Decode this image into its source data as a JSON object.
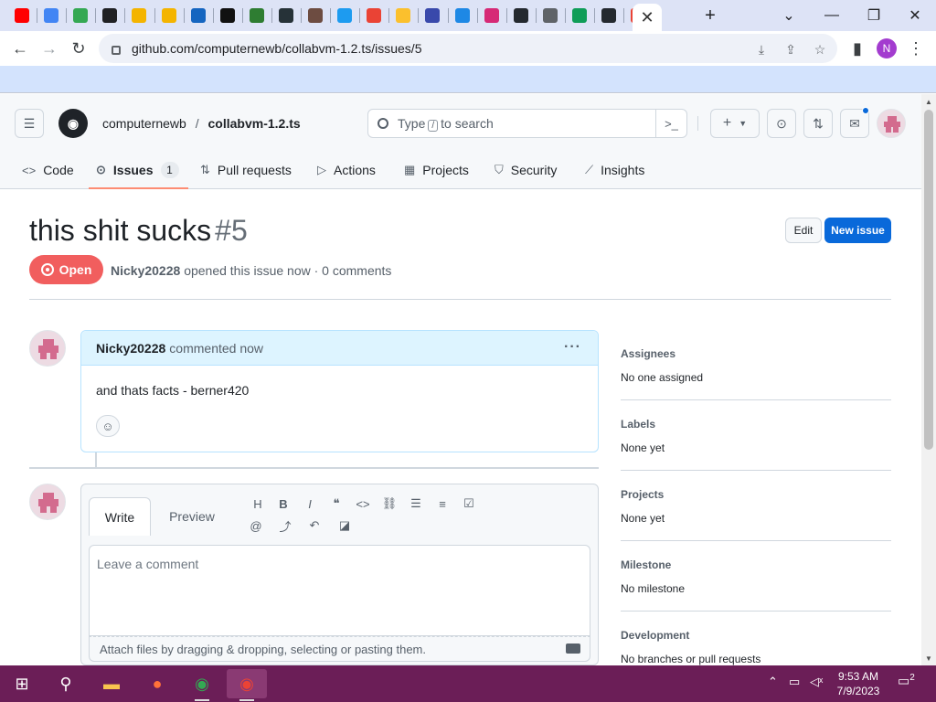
{
  "browser": {
    "active_tab_close": "✕",
    "new_tab": "+",
    "url": "github.com/computernewb/collabvm-1.2.ts/issues/5",
    "profile_initial": "N",
    "tabs": [
      {
        "icon": "youtube-icon",
        "color": "#ff0000"
      },
      {
        "icon": "google-icon",
        "color": "#4285f4"
      },
      {
        "icon": "green-circle-app-icon",
        "color": "#34a853"
      },
      {
        "icon": "gear-app-icon",
        "color": "#202124"
      },
      {
        "icon": "folder-app-icon",
        "color": "#f4b400"
      },
      {
        "icon": "folder-app-icon",
        "color": "#f4b400"
      },
      {
        "icon": "blue-app-icon",
        "color": "#1565c0"
      },
      {
        "icon": "kim-app-icon",
        "color": "#111111"
      },
      {
        "icon": "game-app-icon",
        "color": "#2e7d32"
      },
      {
        "icon": "photo-app-icon",
        "color": "#263238"
      },
      {
        "icon": "dots-app-icon",
        "color": "#6d4c41"
      },
      {
        "icon": "twitter-icon",
        "color": "#1d9bf0"
      },
      {
        "icon": "gmail-icon",
        "color": "#ea4335"
      },
      {
        "icon": "bulb-app-icon",
        "color": "#fbc02d"
      },
      {
        "icon": "site-app-icon",
        "color": "#3949ab"
      },
      {
        "icon": "sonic-app-icon",
        "color": "#1e88e5"
      },
      {
        "icon": "instagram-icon",
        "color": "#d62976"
      },
      {
        "icon": "github-icon",
        "color": "#24292f"
      },
      {
        "icon": "chrome-icon",
        "color": "#5f6368"
      },
      {
        "icon": "drive-icon",
        "color": "#0f9d58"
      },
      {
        "icon": "github-icon",
        "color": "#24292f"
      },
      {
        "icon": "gmail-icon",
        "color": "#ea4335"
      }
    ]
  },
  "header": {
    "owner": "computernewb",
    "separator": "/",
    "repo": "collabvm-1.2.ts",
    "search_prefix": "Type",
    "search_key": "/",
    "search_suffix": "to search"
  },
  "repo_nav": {
    "code": "Code",
    "issues": "Issues",
    "issues_count": "1",
    "pull_requests": "Pull requests",
    "actions": "Actions",
    "projects": "Projects",
    "security": "Security",
    "insights": "Insights"
  },
  "issue": {
    "title": "this shit sucks",
    "number": "#5",
    "edit_label": "Edit",
    "new_issue_label": "New issue",
    "state": "Open",
    "author": "Nicky20228",
    "meta_rest": "opened this issue now · 0 comments"
  },
  "comment": {
    "author": "Nicky20228",
    "action": "commented now",
    "body": "and thats facts - berner420"
  },
  "editor": {
    "write_tab": "Write",
    "preview_tab": "Preview",
    "placeholder": "Leave a comment",
    "attach_hint": "Attach files by dragging & dropping, selecting or pasting them."
  },
  "sidebar": {
    "assignees_title": "Assignees",
    "assignees_value": "No one assigned",
    "labels_title": "Labels",
    "labels_value": "None yet",
    "projects_title": "Projects",
    "projects_value": "None yet",
    "milestone_title": "Milestone",
    "milestone_value": "No milestone",
    "development_title": "Development",
    "development_value": "No branches or pull requests"
  },
  "taskbar": {
    "time": "9:53 AM",
    "date": "7/9/2023",
    "notification_count": "2"
  },
  "colors": {
    "accent_blue": "#0969da",
    "open_state": "#f15e5e",
    "taskbar": "#6b1e57",
    "comment_header": "#ddf4ff"
  }
}
